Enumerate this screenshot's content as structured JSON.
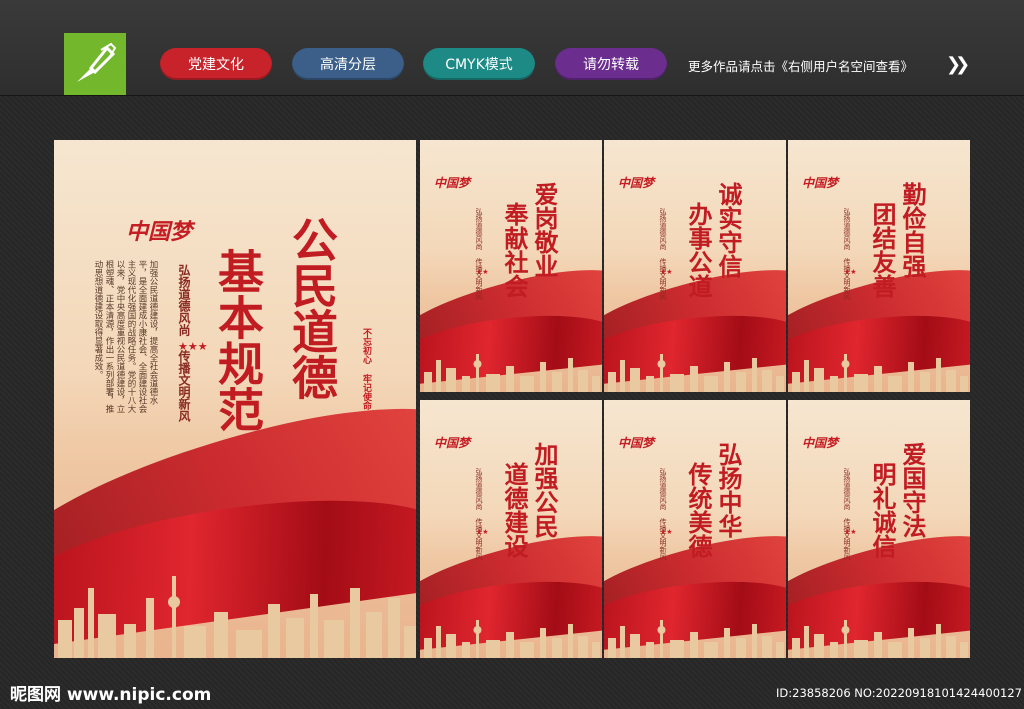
{
  "toolbar": {
    "tags": [
      "党建文化",
      "高清分层",
      "CMYK模式",
      "请勿转载"
    ],
    "hint": "更多作品请点击《右侧用户名空间查看》",
    "colors": {
      "red": "#c8232a",
      "blue": "#3b5f88",
      "teal": "#1d8a86",
      "purple": "#6b2d8e",
      "logo": "#72b72c"
    }
  },
  "main_poster": {
    "logo_text": "中国梦",
    "title_right": "公民道德",
    "title_left": "基本规范",
    "slogan": "弘扬道德风尚 传播文明新风",
    "stamp": "不忘初心 牢记使命",
    "body": "加强公民道德建设，提高全社会道德水平，是全面建成小康社会、全面建设社会主义现代化强国的战略任务。党的十八大以来，党中央高度重视公民道德建设，立根塑魂、正本清源，作出一系列部署，推动思想道德建设取得显著成效。"
  },
  "small_posters": [
    {
      "logo_text": "中国梦",
      "title_a": "爱岗敬业",
      "title_b": "奉献社会",
      "slogan": "弘扬道德风尚 传播文明新风"
    },
    {
      "logo_text": "中国梦",
      "title_a": "诚实守信",
      "title_b": "办事公道",
      "slogan": "弘扬道德风尚 传播文明新风"
    },
    {
      "logo_text": "中国梦",
      "title_a": "勤俭自强",
      "title_b": "团结友善",
      "slogan": "弘扬道德风尚 传播文明新风"
    },
    {
      "logo_text": "中国梦",
      "title_a": "加强公民",
      "title_b": "道德建设",
      "slogan": "弘扬道德风尚 传播文明新风"
    },
    {
      "logo_text": "中国梦",
      "title_a": "弘扬中华",
      "title_b": "传统美德",
      "slogan": "弘扬道德风尚 传播文明新风"
    },
    {
      "logo_text": "中国梦",
      "title_a": "爱国守法",
      "title_b": "明礼诚信",
      "slogan": "弘扬道德风尚 传播文明新风"
    }
  ],
  "footer": {
    "site": "昵图网 www.nipic.com",
    "id": "ID:23858206 NO:20220918101424400127"
  }
}
